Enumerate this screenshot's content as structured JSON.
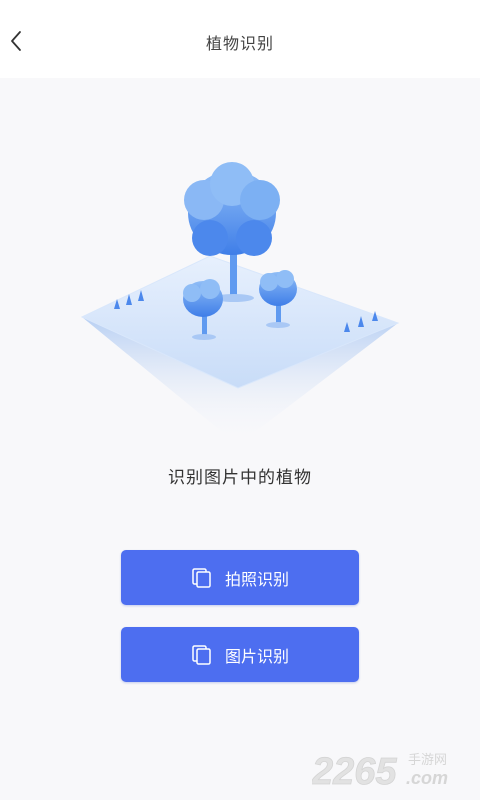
{
  "header": {
    "title": "植物识别",
    "back_icon": "chevron-left-icon"
  },
  "main": {
    "subtitle": "识别图片中的植物",
    "buttons": [
      {
        "label": "拍照识别",
        "icon": "copy-icon"
      },
      {
        "label": "图片识别",
        "icon": "copy-icon"
      }
    ]
  },
  "watermark": {
    "text": "2265",
    "suffix": ".com",
    "tagline": "手游网"
  },
  "colors": {
    "accent": "#4d6ef0",
    "tree": "#3f7ee8",
    "platform": "#d6e6fb"
  }
}
